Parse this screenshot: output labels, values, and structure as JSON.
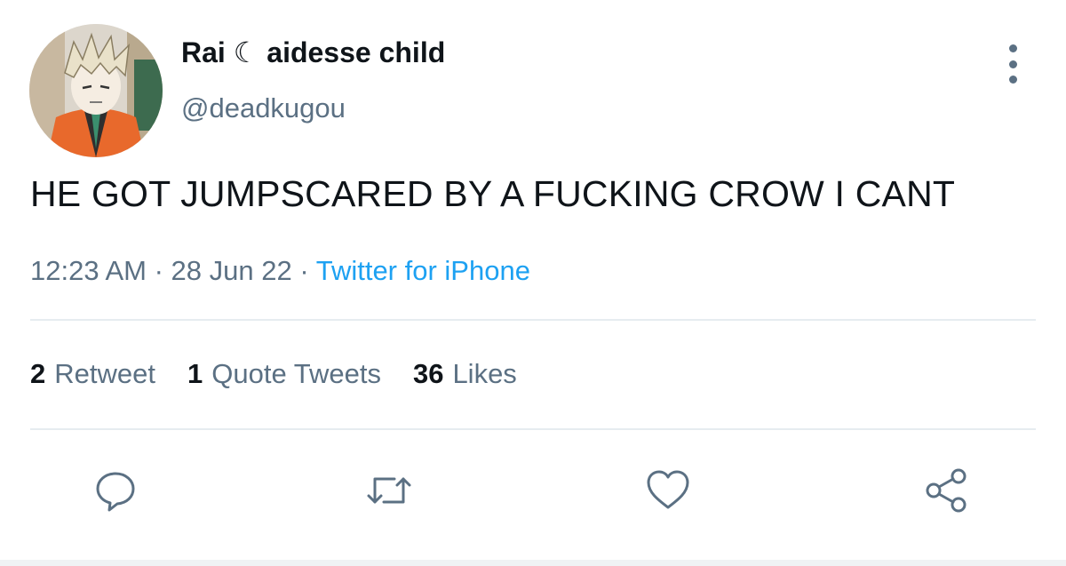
{
  "user": {
    "display_name": "Rai ☾ aidesse child",
    "handle": "@deadkugou"
  },
  "tweet": {
    "text": "HE GOT JUMPSCARED BY A FUCKING CROW I CANT"
  },
  "meta": {
    "time": "12:23 AM",
    "separator": " · ",
    "date": "28 Jun 22",
    "source": "Twitter for iPhone"
  },
  "stats": {
    "retweets_count": "2",
    "retweets_label": "Retweet",
    "quotes_count": "1",
    "quotes_label": "Quote Tweets",
    "likes_count": "36",
    "likes_label": "Likes"
  },
  "icons": {
    "more": "more-vertical-icon",
    "reply": "reply-icon",
    "retweet": "retweet-icon",
    "like": "heart-icon",
    "share": "share-icon"
  },
  "colors": {
    "text_primary": "#0f1419",
    "text_secondary": "#5b7083",
    "link": "#1da1f2",
    "divider": "#e6ecf0"
  }
}
